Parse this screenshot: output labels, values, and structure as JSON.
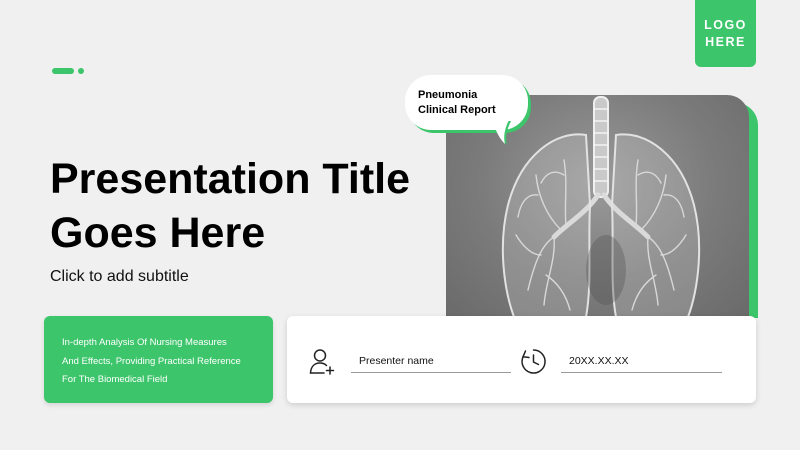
{
  "logo": {
    "line1": "LOGO",
    "line2": "HERE"
  },
  "bubble": {
    "line1": "Pneumonia",
    "line2": "Clinical Report"
  },
  "title": {
    "line1": "Presentation Title",
    "line2": "Goes Here"
  },
  "subtitle": "Click to add subtitle",
  "description": {
    "line1": "In-depth Analysis Of Nursing Measures",
    "line2": "And Effects, Providing Practical Reference",
    "line3": "For The Biomedical Field"
  },
  "presenter": {
    "label": "Presenter name"
  },
  "date": {
    "label": "20XX.XX.XX"
  },
  "icons": {
    "presenter": "add-user-icon",
    "date": "clock-icon",
    "image": "lungs-xray-image"
  },
  "colors": {
    "accent": "#3cc56b",
    "background": "#f0f0f0"
  }
}
